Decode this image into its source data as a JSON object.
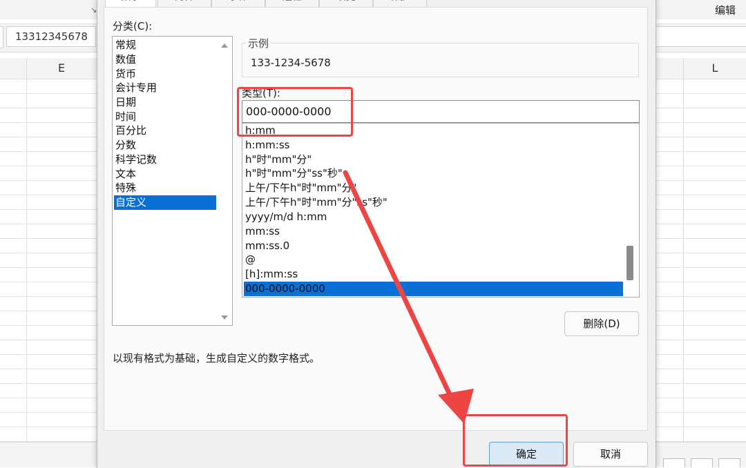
{
  "ribbon": {
    "edit_label": "编辑",
    "launcher_glyph": "↘"
  },
  "formula_bar": {
    "value": "13312345678"
  },
  "columns": {
    "left": "E",
    "right": "L"
  },
  "dialog": {
    "tabs": [
      "数字",
      "对齐",
      "字体",
      "边框",
      "填充",
      "保护"
    ],
    "category_label": "分类(C):",
    "categories": [
      "常规",
      "数值",
      "货币",
      "会计专用",
      "日期",
      "时间",
      "百分比",
      "分数",
      "科学记数",
      "文本",
      "特殊",
      "自定义"
    ],
    "selected_category": "自定义",
    "sample_label": "示例",
    "sample_value": "133-1234-5678",
    "type_label": "类型(T):",
    "type_value": "000-0000-0000",
    "formats": [
      "h:mm",
      "h:mm:ss",
      "h\"时\"mm\"分\"",
      "h\"时\"mm\"分\"ss\"秒\"",
      "上午/下午h\"时\"mm\"分\"",
      "上午/下午h\"时\"mm\"分\"ss\"秒\"",
      "yyyy/m/d h:mm",
      "mm:ss",
      "mm:ss.0",
      "@",
      "[h]:mm:ss",
      "000-0000-0000"
    ],
    "selected_format": "000-0000-0000",
    "delete_label": "删除(D)",
    "description": "以现有格式为基础，生成自定义的数字格式。",
    "ok_label": "确定",
    "cancel_label": "取消"
  },
  "colors": {
    "selection": "#0a70d6",
    "annotation": "#ef4444",
    "primary_button": "#dbe9f7"
  }
}
